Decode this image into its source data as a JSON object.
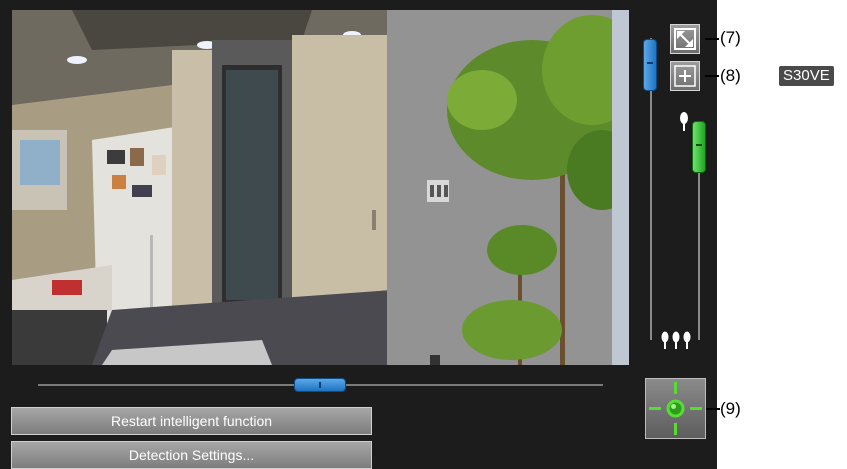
{
  "viewer": {
    "feed_label": "camera-video-feed"
  },
  "controls": {
    "pan_slider": {
      "level": 0.5
    },
    "tilt_slider": {
      "level": 0.0
    },
    "zoom_slider": {
      "level": 0.0
    },
    "fullscreen_icon": "fullscreen-icon",
    "zoom_in_icon": "plus-icon",
    "zoom_in_symbol": "+",
    "center_icon": "crosshair-icon",
    "tele_icon": "single-tree-icon",
    "wide_icon": "three-trees-icon"
  },
  "buttons": {
    "restart": "Restart intelligent function",
    "detection_settings": "Detection Settings..."
  },
  "callouts": {
    "c7": "(7)",
    "c8": "(8)",
    "c8_model": "S30VE",
    "c9": "(9)"
  },
  "colors": {
    "panel_bg": "#1c1c1c",
    "blue_slider": "#1f74c2",
    "green_slider": "#1fa51f",
    "crosshair": "#55dd33"
  }
}
